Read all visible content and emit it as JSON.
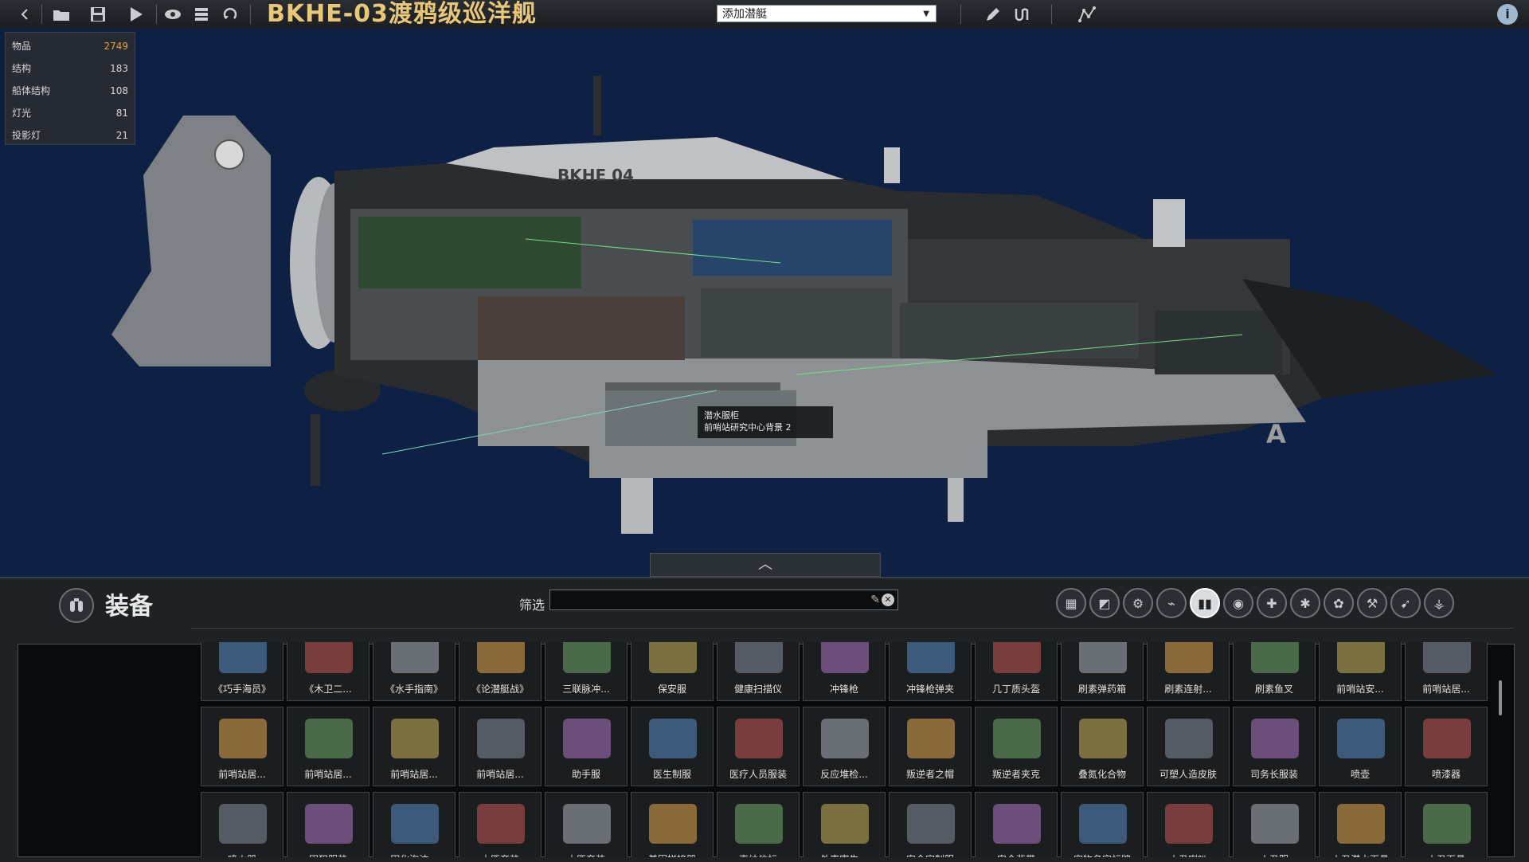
{
  "window": {
    "title": "BKHE-03渡鸦级巡洋舰"
  },
  "toolbar": {
    "add_submarine_value": "添加潜艇",
    "icons": [
      "back-icon",
      "open-folder-icon",
      "save-icon",
      "play-icon",
      "visibility-icon",
      "layers-icon",
      "undo-icon",
      "pencil-icon",
      "wiring-icon",
      "waypoint-icon",
      "info-icon"
    ]
  },
  "stats": [
    {
      "label": "物品",
      "value": "2749",
      "highlight": true
    },
    {
      "label": "结构",
      "value": "183"
    },
    {
      "label": "船体结构",
      "value": "108"
    },
    {
      "label": "灯光",
      "value": "81"
    },
    {
      "label": "投影灯",
      "value": "21"
    }
  ],
  "ship": {
    "hull_marking": "BKHE 04",
    "marker_letter": "A"
  },
  "tooltip": {
    "line1": "潜水服柜",
    "line2": "前哨站研究中心背景 2"
  },
  "panel": {
    "title": "装备",
    "filter_label": "筛选",
    "filter_value": "",
    "categories": [
      "all",
      "structure",
      "machine",
      "electrical",
      "equipment",
      "diving-gear",
      "medical",
      "explosives",
      "material",
      "tools",
      "weapons",
      "alien",
      "misc"
    ]
  },
  "items": [
    [
      "《巧手海员》",
      "《木卫二...",
      "《水手指南》",
      "《论潜艇战》",
      "三联脉冲...",
      "保安服",
      "健康扫描仪",
      "冲锋枪",
      "冲锋枪弹夹",
      "几丁质头盔",
      "刷素弹药箱",
      "刷素连射...",
      "刷素鱼叉",
      "前哨站安...",
      "前哨站居..."
    ],
    [
      "前哨站居...",
      "前哨站居...",
      "前哨站居...",
      "前哨站居...",
      "助手服",
      "医生制服",
      "医疗人员服装",
      "反应堆检...",
      "叛逆者之帽",
      "叛逆者夹克",
      "叠氮化合物",
      "可塑人造皮肤",
      "司务长服装",
      "喷壶",
      "喷漆器"
    ],
    [
      "喷火器",
      "囚犯服装",
      "固化泡沫...",
      "土匪套装",
      "土匪套装",
      "基因拼接器",
      "声纳信标",
      "外壳寄生...",
      "安全官制服",
      "安全背带",
      "宠物名字标牌",
      "小丑喇叭",
      "小丑服",
      "小丑潜水面具",
      "小丑面具"
    ]
  ],
  "colors": {
    "background": "#0e2145",
    "title_gold": "#e8c77a",
    "highlight_orange": "#e3a040"
  }
}
